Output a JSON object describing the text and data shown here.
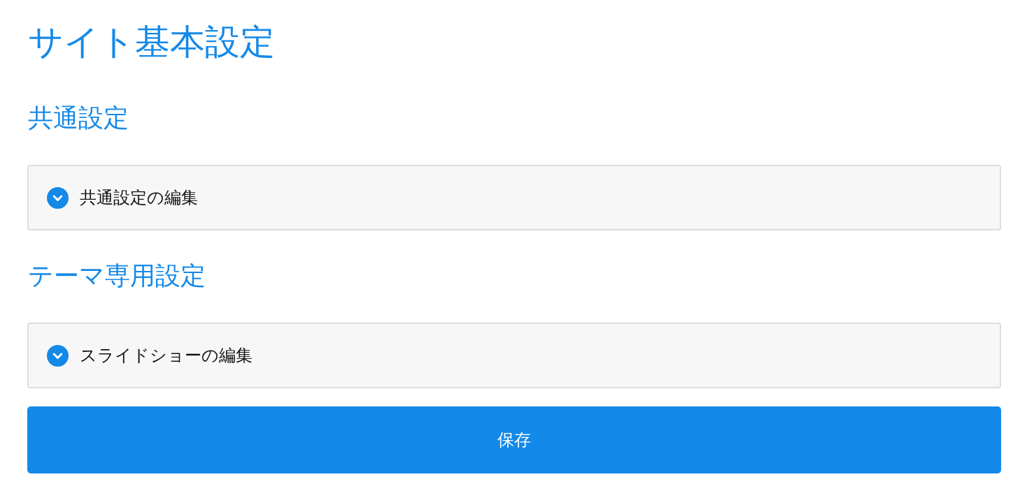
{
  "page": {
    "title": "サイト基本設定"
  },
  "sections": [
    {
      "heading": "共通設定",
      "panels": [
        {
          "label": "共通設定の編集",
          "expanded": false
        }
      ]
    },
    {
      "heading": "テーマ専用設定",
      "panels": [
        {
          "label": "スライドショーの編集",
          "expanded": false
        }
      ]
    }
  ],
  "save_button": {
    "label": "保存"
  }
}
